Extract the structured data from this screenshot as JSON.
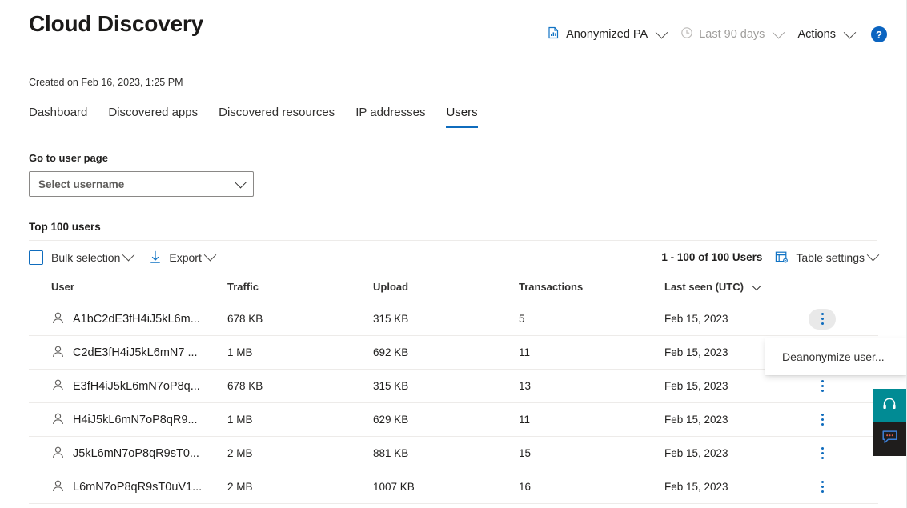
{
  "header": {
    "title": "Cloud Discovery",
    "report_selector": {
      "label": "Anonymized PA",
      "icon": "report-bar-chart-icon"
    },
    "date_range": {
      "label": "Last 90 days",
      "icon": "clock-icon",
      "disabled": true
    },
    "actions": {
      "label": "Actions"
    },
    "help": {
      "label": "?",
      "icon": "help-icon",
      "color": "#0b64c0"
    }
  },
  "meta": {
    "created": "Created on Feb 16, 2023, 1:25 PM"
  },
  "tabs": [
    {
      "label": "Dashboard",
      "active": false
    },
    {
      "label": "Discovered apps",
      "active": false
    },
    {
      "label": "Discovered resources",
      "active": false
    },
    {
      "label": "IP addresses",
      "active": false
    },
    {
      "label": "Users",
      "active": true
    }
  ],
  "user_page": {
    "label": "Go to user page",
    "select_placeholder": "Select username"
  },
  "table_section": {
    "title": "Top 100 users",
    "toolbar": {
      "bulk_selection": "Bulk selection",
      "export": "Export",
      "count": "1 - 100 of 100 Users",
      "table_settings": "Table settings"
    },
    "columns": [
      "User",
      "Traffic",
      "Upload",
      "Transactions",
      "Last seen (UTC)"
    ],
    "sorted_column": "Last seen (UTC)",
    "rows": [
      {
        "user": "A1bC2dE3fH4iJ5kL6m...",
        "traffic": "678 KB",
        "upload": "315 KB",
        "transactions": "5",
        "last_seen": "Feb 15, 2023"
      },
      {
        "user": "C2dE3fH4iJ5kL6mN7 ...",
        "traffic": "1 MB",
        "upload": "692 KB",
        "transactions": "11",
        "last_seen": "Feb 15, 2023"
      },
      {
        "user": "E3fH4iJ5kL6mN7oP8q...",
        "traffic": "678 KB",
        "upload": "315 KB",
        "transactions": "13",
        "last_seen": "Feb 15, 2023"
      },
      {
        "user": "H4iJ5kL6mN7oP8qR9...",
        "traffic": "1 MB",
        "upload": "629 KB",
        "transactions": "11",
        "last_seen": "Feb 15, 2023"
      },
      {
        "user": "J5kL6mN7oP8qR9sT0...",
        "traffic": "2 MB",
        "upload": "881 KB",
        "transactions": "15",
        "last_seen": "Feb 15, 2023"
      },
      {
        "user": "L6mN7oP8qR9sT0uV1...",
        "traffic": "2 MB",
        "upload": "1007 KB",
        "transactions": "16",
        "last_seen": "Feb 15, 2023"
      }
    ]
  },
  "context_menu": {
    "open_for_row": 0,
    "items": [
      {
        "label": "Deanonymize user..."
      }
    ]
  },
  "widgets": [
    {
      "name": "support",
      "icon": "headset-icon",
      "color": "#018b94"
    },
    {
      "name": "feedback",
      "icon": "chat-icon",
      "color": "#1f1d1c"
    }
  ]
}
